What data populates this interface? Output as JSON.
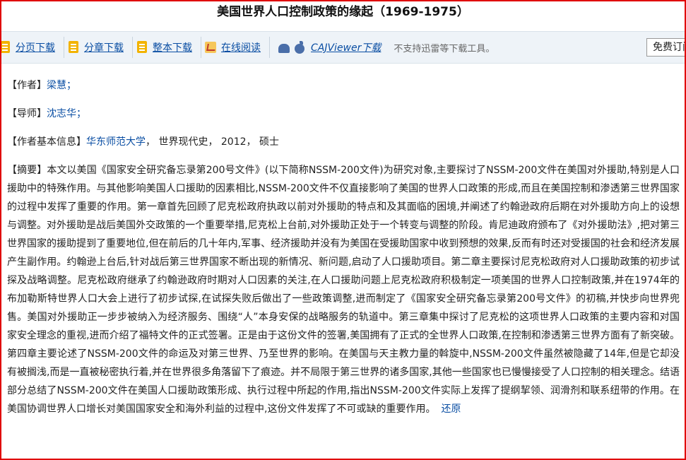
{
  "page": {
    "title": "美国世界人口控制政策的缘起（1969-1975）"
  },
  "toolbar": {
    "items": [
      {
        "label": "分页下载",
        "icon": "document-download-icon"
      },
      {
        "label": "分章下载",
        "icon": "document-download-icon"
      },
      {
        "label": "整本下载",
        "icon": "document-download-icon"
      },
      {
        "label": "在线阅读",
        "icon": "read-online-icon"
      }
    ],
    "caj_label": "CAJViewer下载",
    "note": "不支持迅雷等下载工具。",
    "free_button": "免费订阅"
  },
  "meta": {
    "author_label": "【作者】",
    "author": "梁慧；",
    "advisor_label": "【导师】",
    "advisor": "沈志华；",
    "info_label": "【作者基本信息】",
    "university": "华东师范大学",
    "info_rest": "，  世界现代史，  2012，  硕士"
  },
  "abstract": {
    "label": "【摘要】",
    "text": "本文以美国《国家安全研究备忘录第200号文件》(以下简称NSSM-200文件)为研究对象,主要探讨了NSSM-200文件在美国对外援助,特别是人口援助中的特殊作用。与其他影响美国人口援助的因素相比,NSSM-200文件不仅直接影响了美国的世界人口政策的形成,而且在美国控制和渗透第三世界国家的过程中发挥了重要的作用。第一章首先回顾了尼克松政府执政以前对外援助的特点和及其面临的困境,并阐述了约翰逊政府后期在对外援助方向上的设想与调整。对外援助是战后美国外交政策的一个重要举措,尼克松上台前,对外援助正处于一个转变与调整的阶段。肯尼迪政府颁布了《对外援助法》,把对第三世界国家的援助提到了重要地位,但在前后的几十年内,军事、经济援助并没有为美国在受援助国家中收到预想的效果,反而有时还对受援国的社会和经济发展产生副作用。约翰逊上台后,针对战后第三世界国家不断出现的新情况、新问题,启动了人口援助项目。第二章主要探讨尼克松政府对人口援助政策的初步试探及战略调整。尼克松政府继承了约翰逊政府时期对人口因素的关注,在人口援助问题上尼克松政府积极制定一项美国的世界人口控制政策,并在1974年的布加勒斯特世界人口大会上进行了初步试探,在试探失败后做出了一些政策调整,进而制定了《国家安全研究备忘录第200号文件》的初稿,并快步向世界兜售。美国对外援助正一步步被纳入为经济服务、围绕“人”本身安保的战略服务的轨道中。第三章集中探讨了尼克松的这项世界人口政策的主要内容和对国家安全理念的重视,进而介绍了福特文件的正式签署。正是由于这份文件的签署,美国拥有了正式的全世界人口政策,在控制和渗透第三世界方面有了新突破。第四章主要论述了NSSM-200文件的命运及对第三世界、乃至世界的影响。在美国与天主教力量的斡旋中,NSSM-200文件虽然被隐藏了14年,但是它却没有被搁浅,而是一直被秘密执行着,并在世界很多角落留下了痕迹。并不局限于第三世界的诸多国家,其他一些国家也已慢慢接受了人口控制的相关理念。结语部分总结了NSSM-200文件在美国人口援助政策形成、执行过程中所起的作用,指出NSSM-200文件实际上发挥了提纲挈领、润滑剂和联系纽带的作用。在美国协调世界人口增长对美国国家安全和海外利益的过程中,这份文件发挥了不可或缺的重要作用。",
    "restore": "还原"
  }
}
